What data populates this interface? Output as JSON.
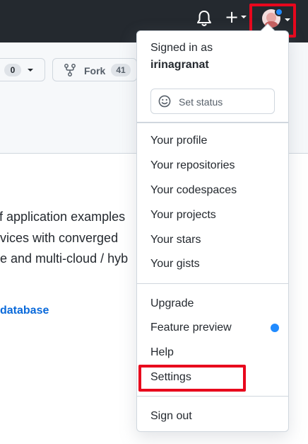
{
  "header": {
    "notifications_icon": "bell-icon",
    "create_icon": "plus-icon",
    "create_label": "+",
    "avatar_icon": "avatar",
    "colors": {
      "background": "#24292f",
      "highlight": "#e8071d",
      "dot": "#218bff"
    }
  },
  "repo": {
    "star_count": "0",
    "fork_label": "Fork",
    "fork_count": "41",
    "description_lines": [
      "f application examples",
      "vices with converged",
      "e and multi-cloud / hyb"
    ],
    "topic_link": "database"
  },
  "menu": {
    "signed_in_as": "Signed in as",
    "username": "irinagranat",
    "set_status_label": "Set status",
    "group1": [
      "Your profile",
      "Your repositories",
      "Your codespaces",
      "Your projects",
      "Your stars",
      "Your gists"
    ],
    "group2": [
      "Upgrade",
      "Feature preview",
      "Help",
      "Settings"
    ],
    "sign_out": "Sign out"
  }
}
